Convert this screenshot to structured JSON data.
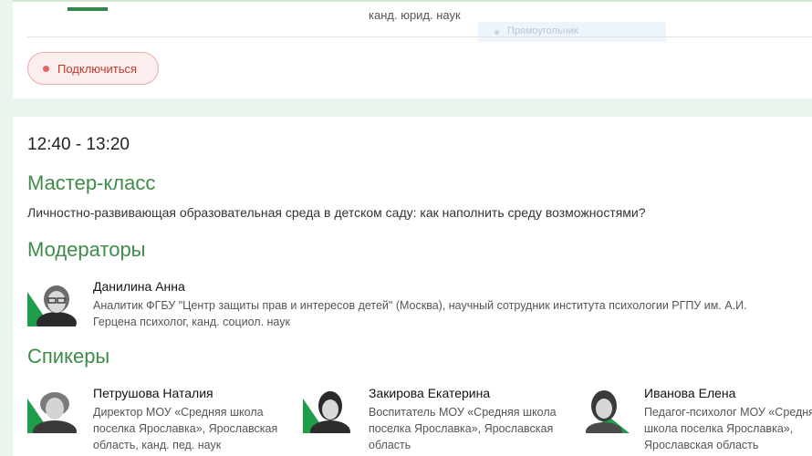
{
  "top": {
    "caption": "канд. юрид. наук",
    "ghost_label": "Прямоугольник",
    "join_label": "Подключиться"
  },
  "session": {
    "time": "12:40 - 13:20",
    "type": "Мастер-класс",
    "description": "Личностно-развивающая образовательная среда в детском саду: как наполнить среду возможностями?",
    "moderators_title": "Модераторы",
    "moderators": [
      {
        "name": "Данилина Анна",
        "description_line1": "Аналитик ФГБУ \"Центр защиты прав и интересов детей\" (Москва), научный сотрудник института психологии РГПУ им. А.И.",
        "description_line2": "Герцена психолог, канд. социол. наук"
      }
    ],
    "speakers_title": "Спикеры",
    "speakers": [
      {
        "name": "Петрушова Наталия",
        "line1": "Директор МОУ «Средняя школа",
        "line2": "поселка Ярославка», Ярославская",
        "line3": "область, канд. пед. наук"
      },
      {
        "name": "Закирова Екатерина",
        "line1": "Воспитатель МОУ «Средняя школа",
        "line2": "поселка Ярославка», Ярославская",
        "line3": "область"
      },
      {
        "name": "Иванова Елена",
        "line1": "Педагог-психолог МОУ «Средняя",
        "line2": "школа поселка Ярославка»,",
        "line3": "Ярославская область"
      }
    ]
  },
  "colors": {
    "accent_green": "#3f8c4a",
    "avatar_green": "#1e9e4a",
    "join_red": "#c0392b"
  }
}
